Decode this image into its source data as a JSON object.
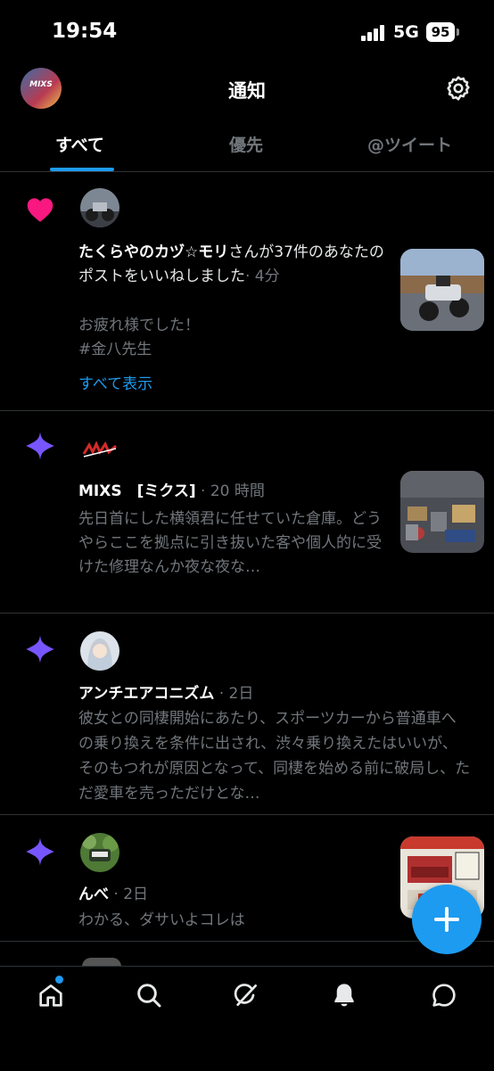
{
  "status_bar": {
    "time": "19:54",
    "network": "5G",
    "battery": "95"
  },
  "header": {
    "title": "通知",
    "avatar_text": "MIXS"
  },
  "tabs": [
    {
      "label": "すべて",
      "active": true
    },
    {
      "label": "優先",
      "active": false
    },
    {
      "label": "@ツイート",
      "active": false
    }
  ],
  "notifications": [
    {
      "kind": "heart-icon",
      "name": "たくらやのカヅ☆モリ",
      "action": "さんが37件のあなたのポストをいいねしました",
      "time": "· 4分",
      "line1": "お疲れ様でした！",
      "line2": "#金八先生",
      "show_all": "すべて表示"
    },
    {
      "kind": "sparkle-icon",
      "name": "MIXS　[ミクス]",
      "time": "· 20 時間",
      "text": "先日首にした横領君に任せていた倉庫。どうやらここを拠点に引き抜いた客や個人的に受けた修理なんか夜な夜な…"
    },
    {
      "kind": "sparkle-icon",
      "name": "アンチエアコニズム",
      "time": "· 2日",
      "text": "彼女との同棲開始にあたり、スポーツカーから普通車への乗り換えを条件に出され、渋々乗り換えたはいいが、そのもつれが原因となって、同棲を始める前に破局し、ただ愛車を売っただけとな…"
    },
    {
      "kind": "sparkle-icon",
      "name": "んべ",
      "time": "· 2日",
      "text": "わかる、ダサいよコレは"
    }
  ],
  "colors": {
    "accent": "#1d9bf0",
    "like": "#f91880",
    "sparkle": "#7856ff",
    "muted": "#71767b"
  },
  "bottom_nav": [
    "home-icon",
    "search-icon",
    "grok-icon",
    "bell-icon",
    "messages-icon"
  ]
}
